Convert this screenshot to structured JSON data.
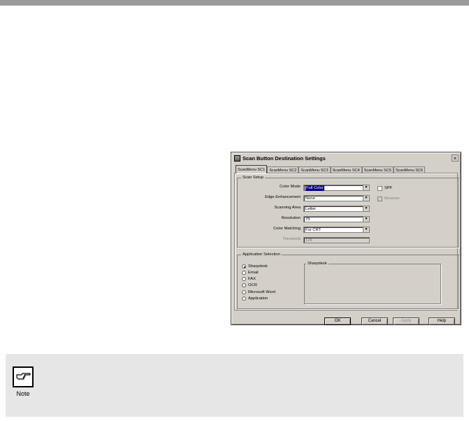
{
  "window": {
    "title": "Scan Button Destination Settings",
    "close_glyph": "×"
  },
  "tabs": [
    {
      "label": "ScanMenu SC1",
      "active": true
    },
    {
      "label": "ScanMenu SC2",
      "active": false
    },
    {
      "label": "ScanMenu SC3",
      "active": false
    },
    {
      "label": "ScanMenu SC4",
      "active": false
    },
    {
      "label": "ScanMenu SC5",
      "active": false
    },
    {
      "label": "ScanMenu SC6",
      "active": false
    }
  ],
  "scan_setup": {
    "title": "Scan Setup",
    "color_mode": {
      "label": "Color Mode",
      "value": "Full Color"
    },
    "edge_enhancement": {
      "label": "Edge Enhancement",
      "value": "None"
    },
    "scanning_area": {
      "label": "Scanning Area",
      "value": "Letter"
    },
    "resolution": {
      "label": "Resolution",
      "value": "75"
    },
    "color_matching": {
      "label": "Color Matching",
      "value": "For CRT"
    },
    "threshold": {
      "label": "Threshold",
      "value": "128"
    },
    "spf": {
      "label": "SPF",
      "checked": false
    },
    "reverse": {
      "label": "Reverse",
      "checked": false,
      "disabled": true
    }
  },
  "application_selection": {
    "title": "Application Selection",
    "options": [
      {
        "label": "Sharpdesk",
        "checked": true
      },
      {
        "label": "Email",
        "checked": false
      },
      {
        "label": "FAX",
        "checked": false
      },
      {
        "label": "OCR",
        "checked": false
      },
      {
        "label": "Microsoft Word",
        "checked": false
      },
      {
        "label": "Application",
        "checked": false
      }
    ],
    "detail_title": "Sharpdesk"
  },
  "buttons": {
    "ok": "OK",
    "cancel": "Cancel",
    "apply": "Apply",
    "help": "Help"
  },
  "note": {
    "label": "Note",
    "icon": "pointing-hand-icon"
  }
}
